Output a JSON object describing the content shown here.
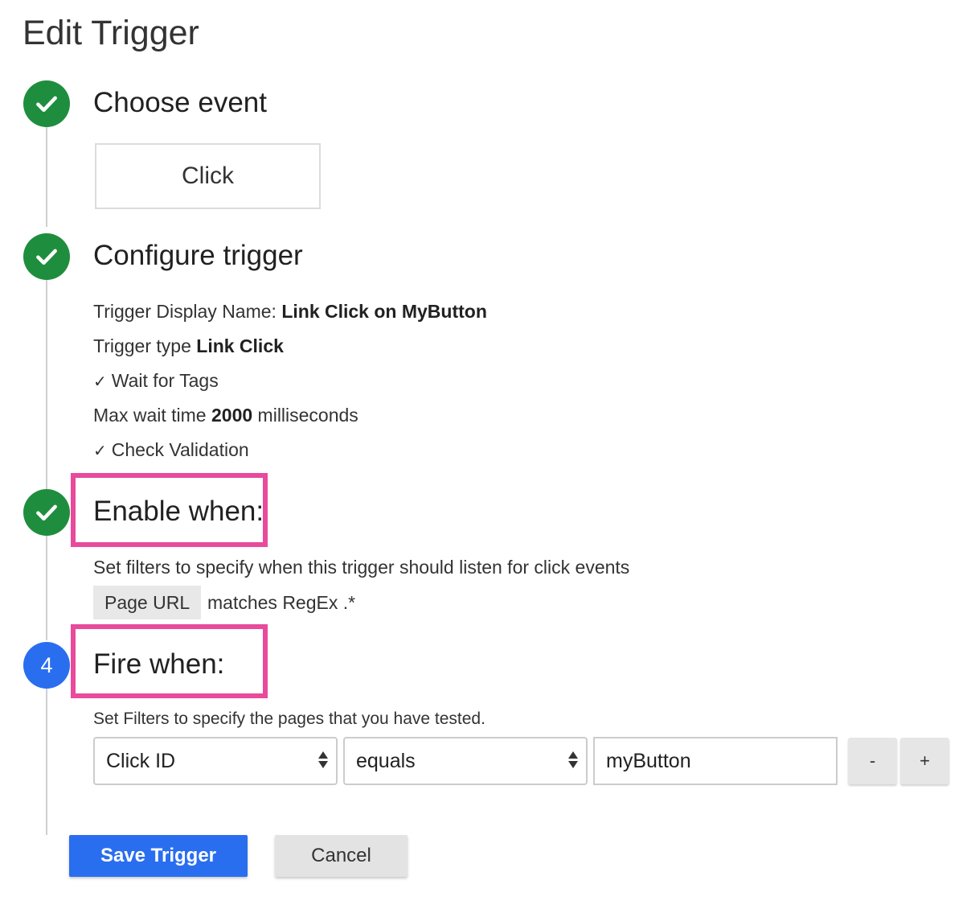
{
  "page": {
    "title": "Edit Trigger"
  },
  "steps": [
    {
      "title": "Choose event",
      "status": "complete",
      "icon": "check-icon"
    },
    {
      "title": "Configure trigger",
      "status": "complete",
      "icon": "check-icon"
    },
    {
      "title": "Enable when:",
      "status": "complete",
      "icon": "check-icon"
    },
    {
      "title": "Fire when:",
      "status": "active",
      "number": "4"
    }
  ],
  "choose_event": {
    "event": "Click"
  },
  "configure": {
    "display_name_label": "Trigger Display Name:",
    "display_name_value": "Link Click on MyButton",
    "type_label": "Trigger type",
    "type_value": "Link Click",
    "wait_for_tags": "Wait for Tags",
    "max_wait_label": "Max wait time",
    "max_wait_value": "2000",
    "max_wait_unit": "milliseconds",
    "check_validation": "Check Validation",
    "check_glyph": "✓"
  },
  "enable_when": {
    "description": "Set filters to specify when this trigger should listen for click events",
    "filter_variable": "Page URL",
    "filter_condition": "matches RegEx .*"
  },
  "fire_when": {
    "description": "Set Filters to specify the pages that you have tested.",
    "variable": "Click ID",
    "operator": "equals",
    "value": "myButton",
    "remove_label": "-",
    "add_label": "+"
  },
  "actions": {
    "save_label": "Save Trigger",
    "cancel_label": "Cancel"
  },
  "colors": {
    "complete": "#1e8e3e",
    "active": "#2a6ef0",
    "highlight": "#e84a9c",
    "primary_button": "#2a6ef0"
  }
}
